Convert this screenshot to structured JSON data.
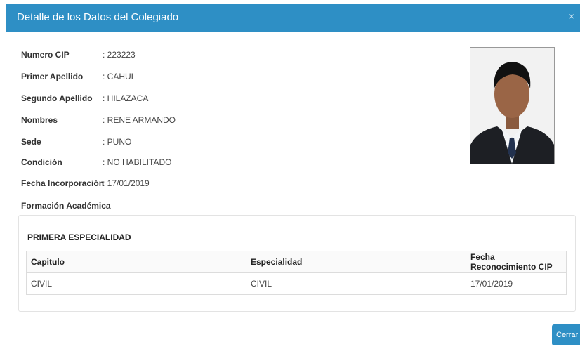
{
  "modal": {
    "title": "Detalle de los Datos del Colegiado",
    "close_icon": "close-icon",
    "close_glyph": "×"
  },
  "fields": [
    {
      "label": "Numero CIP",
      "value": ": 223223"
    },
    {
      "label": "Primer Apellido",
      "value": ": CAHUI"
    },
    {
      "label": "Segundo Apellido",
      "value": ": HILAZACA"
    },
    {
      "label": "Nombres",
      "value": ": RENE ARMANDO"
    },
    {
      "label": "Sede",
      "value": ": PUNO"
    },
    {
      "label": "Condición",
      "value": ": NO HABILITADO"
    },
    {
      "label": "Fecha Incorporación",
      "value": ": 17/01/2019"
    }
  ],
  "formacion": {
    "title": "Formación Académica",
    "especialidad_title": "PRIMERA ESPECIALIDAD",
    "columns": [
      "Capitulo",
      "Especialidad",
      "Fecha Reconocimiento CIP"
    ],
    "rows": [
      [
        "CIVIL",
        "CIVIL",
        "17/01/2019"
      ]
    ]
  },
  "footer": {
    "close_label": "Cerrar"
  },
  "colors": {
    "header": "#2e8fc5",
    "button": "#2e8fc5"
  }
}
